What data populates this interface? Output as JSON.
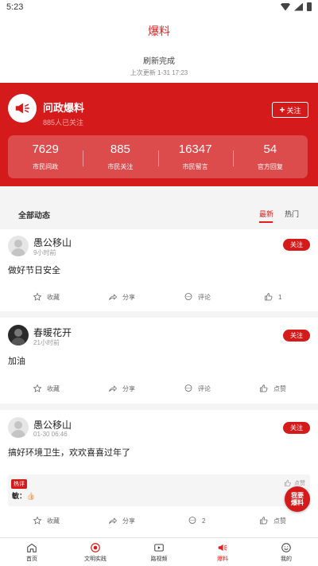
{
  "status": {
    "time": "5:23"
  },
  "header": {
    "title": "爆料"
  },
  "refresh": {
    "status": "刷新完成",
    "last_update": "上次更新 1-31 17:23"
  },
  "channel": {
    "name": "问政爆料",
    "fans": "885人已关注",
    "follow_label": "关注",
    "stats": [
      {
        "value": "7629",
        "label": "市民问政"
      },
      {
        "value": "885",
        "label": "市民关注"
      },
      {
        "value": "16347",
        "label": "市民留言"
      },
      {
        "value": "54",
        "label": "官方回复"
      }
    ]
  },
  "filter": {
    "all_label": "全部动态",
    "tab_latest": "最新",
    "tab_hot": "热门"
  },
  "posts": [
    {
      "user": "愚公移山",
      "time": "9小时前",
      "follow": "关注",
      "content": "做好节日安全",
      "actions": {
        "collect": "收藏",
        "share": "分享",
        "comment": "评论",
        "like": "1"
      }
    },
    {
      "user": "春暖花开",
      "time": "21小时前",
      "follow": "关注",
      "content": "加油",
      "actions": {
        "collect": "收藏",
        "share": "分享",
        "comment": "评论",
        "like": "点赞"
      }
    },
    {
      "user": "愚公移山",
      "time": "01-30 06:46",
      "follow": "关注",
      "content": "搞好环境卫生，欢欢喜喜过年了",
      "hot_comment": {
        "tag": "热评",
        "text": "敏：👍🏻",
        "like": "点赞"
      },
      "actions": {
        "collect": "收藏",
        "share": "分享",
        "comment": "2",
        "like": "点赞"
      }
    }
  ],
  "fab": {
    "line1": "我要",
    "line2": "爆料"
  },
  "tabbar": {
    "items": [
      {
        "label": "首页",
        "icon": "home-icon"
      },
      {
        "label": "文明实践",
        "icon": "badge-icon"
      },
      {
        "label": "路视频",
        "icon": "video-icon"
      },
      {
        "label": "爆料",
        "icon": "megaphone-icon"
      },
      {
        "label": "我的",
        "icon": "smile-icon"
      }
    ],
    "active_color": "#e02020"
  },
  "colors": {
    "brand": "#d41a1a"
  }
}
